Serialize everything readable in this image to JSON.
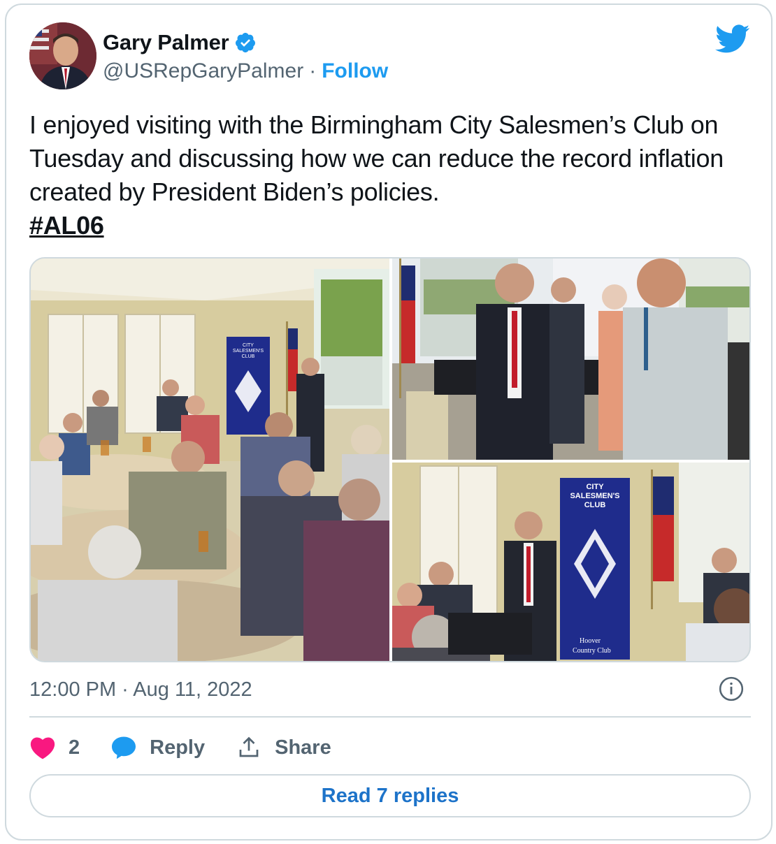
{
  "author": {
    "name": "Gary Palmer",
    "handle": "@USRepGaryPalmer",
    "separator": "·",
    "follow_label": "Follow"
  },
  "tweet": {
    "text": "I enjoyed visiting with the Birmingham City Salesmen’s Club on Tuesday and discussing how we can reduce the record inflation created by President Biden’s policies.",
    "hashtag": "#AL06",
    "timestamp": "12:00 PM · Aug 11, 2022"
  },
  "photos": {
    "banner_line1": "CITY",
    "banner_line2": "SALESMEN'S",
    "banner_line3": "CLUB",
    "banner_footer1": "Hoover",
    "banner_footer2": "Country Club"
  },
  "actions": {
    "like_count": "2",
    "reply_label": "Reply",
    "share_label": "Share"
  },
  "read_replies_label": "Read 7 replies",
  "colors": {
    "accent": "#1d9bf0",
    "like": "#f91880",
    "secondary_text": "#536471",
    "border": "#cfd9de"
  }
}
